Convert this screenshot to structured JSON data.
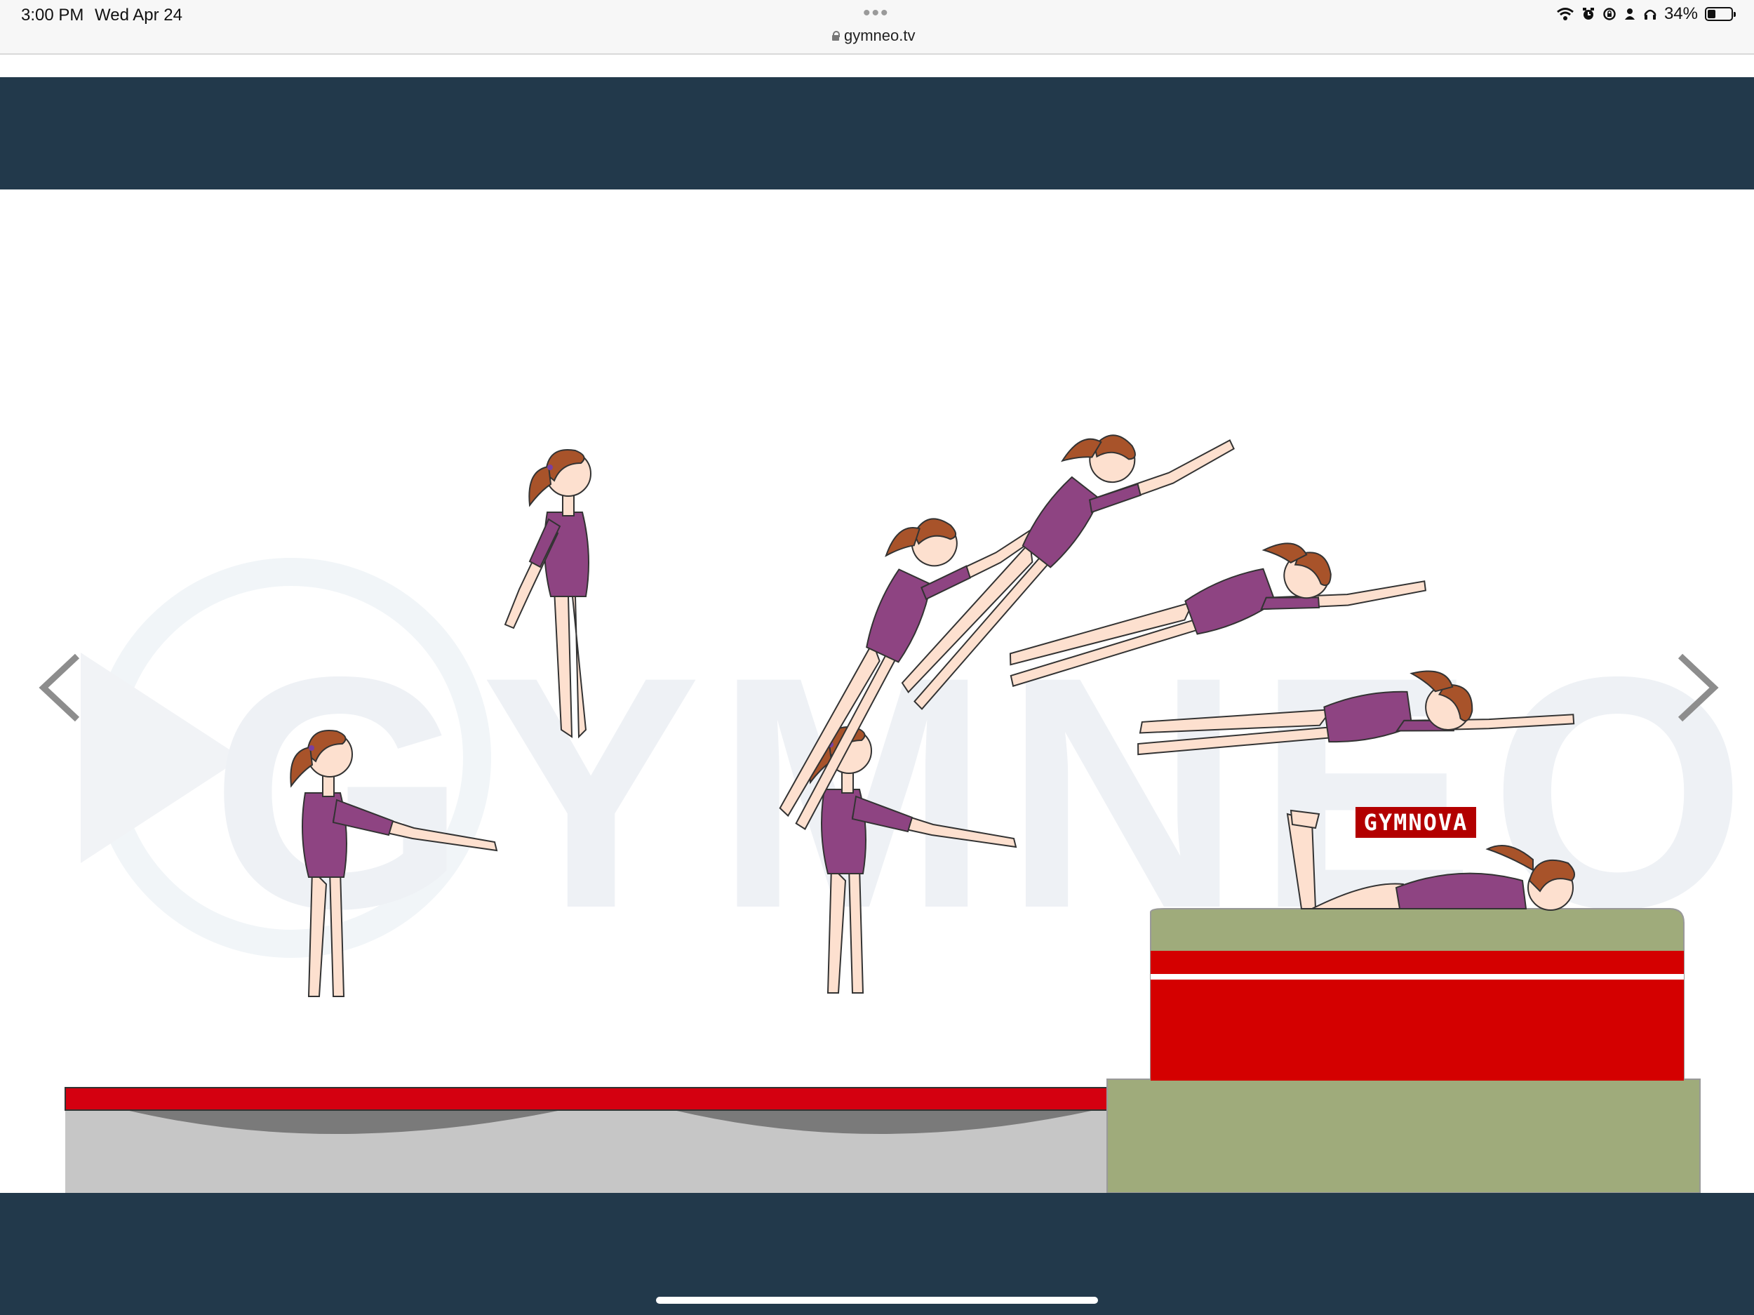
{
  "status_bar": {
    "time": "3:00 PM",
    "date": "Wed Apr 24",
    "battery_percent_label": "34%",
    "battery_level": 0.34,
    "icons": [
      "wifi-icon",
      "alarm-icon",
      "screen-lock-icon",
      "person-icon",
      "headphones-icon",
      "battery-icon"
    ]
  },
  "browser": {
    "menu_dots": "•••",
    "url": "gymneo.tv"
  },
  "slide": {
    "brand_label": "GYMNOVA",
    "colors": {
      "leotard": "#8e4482",
      "skin": "#fde0cf",
      "hair": "#a8532a",
      "box_red": "#d40000",
      "box_green": "#9fab7b",
      "mat_red": "#d40010",
      "trampoline_gray": "#c6c6c6"
    }
  },
  "watermark": {
    "text": "GYMNEO"
  },
  "navigation": {
    "prev_icon": "chevron-left-icon",
    "next_icon": "chevron-right-icon"
  }
}
